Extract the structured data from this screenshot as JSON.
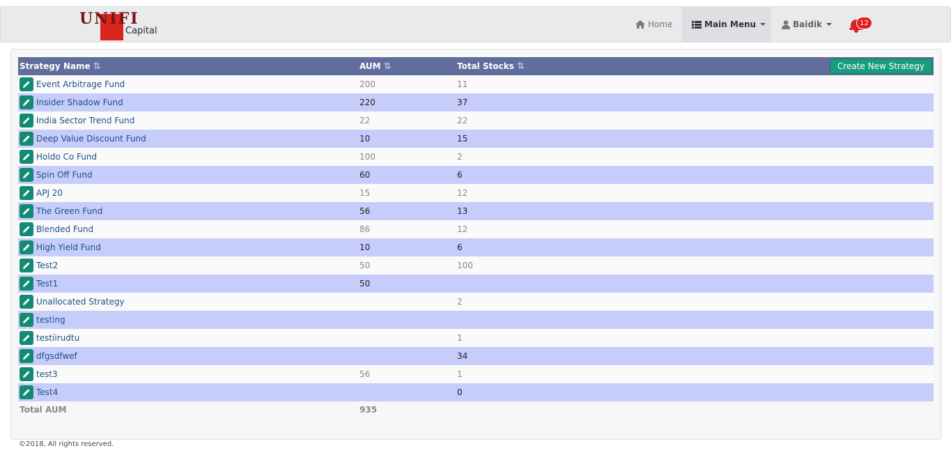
{
  "brand": {
    "logo_text": "UNIFI",
    "logo_subtext": "Capital"
  },
  "nav": {
    "home_label": "Home",
    "main_menu_label": "Main Menu",
    "user_label": "Baidik",
    "notification_count": "12"
  },
  "table": {
    "columns": {
      "name": "Strategy Name",
      "aum": "AUM",
      "stocks": "Total Stocks"
    },
    "create_button_label": "Create New Strategy",
    "rows": [
      {
        "name": "Event Arbitrage Fund",
        "aum": "200",
        "stocks": "11"
      },
      {
        "name": "Insider Shadow Fund",
        "aum": "220",
        "stocks": "37"
      },
      {
        "name": "India Sector Trend Fund",
        "aum": "22",
        "stocks": "22"
      },
      {
        "name": "Deep Value Discount Fund",
        "aum": "10",
        "stocks": "15"
      },
      {
        "name": "Holdo Co Fund",
        "aum": "100",
        "stocks": "2"
      },
      {
        "name": "Spin Off Fund",
        "aum": "60",
        "stocks": "6"
      },
      {
        "name": "APJ 20",
        "aum": "15",
        "stocks": "12"
      },
      {
        "name": "The Green Fund",
        "aum": "56",
        "stocks": "13"
      },
      {
        "name": "Blended Fund",
        "aum": "86",
        "stocks": "12"
      },
      {
        "name": "High Yield Fund",
        "aum": "10",
        "stocks": "6"
      },
      {
        "name": "Test2",
        "aum": "50",
        "stocks": "100"
      },
      {
        "name": "Test1",
        "aum": "50",
        "stocks": ""
      },
      {
        "name": "Unallocated Strategy",
        "aum": "",
        "stocks": "2"
      },
      {
        "name": "testing",
        "aum": "",
        "stocks": ""
      },
      {
        "name": "testiirudtu",
        "aum": "",
        "stocks": "1"
      },
      {
        "name": "dfgsdfwef",
        "aum": "",
        "stocks": "34"
      },
      {
        "name": "test3",
        "aum": "56",
        "stocks": "1"
      },
      {
        "name": "Test4",
        "aum": "",
        "stocks": "0"
      }
    ],
    "total_label": "Total AUM",
    "total_value": "935"
  },
  "footer": {
    "copyright": "©2018, All rights reserved."
  },
  "colors": {
    "header_bg": "#616d9c",
    "row_alt_bg": "#c7cdfa",
    "edit_button": "#138a73",
    "create_button": "#1a9c81",
    "notification": "#e21b1b",
    "brand_red": "#d6251f"
  },
  "icons": [
    "home-icon",
    "list-icon",
    "user-icon",
    "bell-icon",
    "sort-icon",
    "pencil-icon"
  ]
}
